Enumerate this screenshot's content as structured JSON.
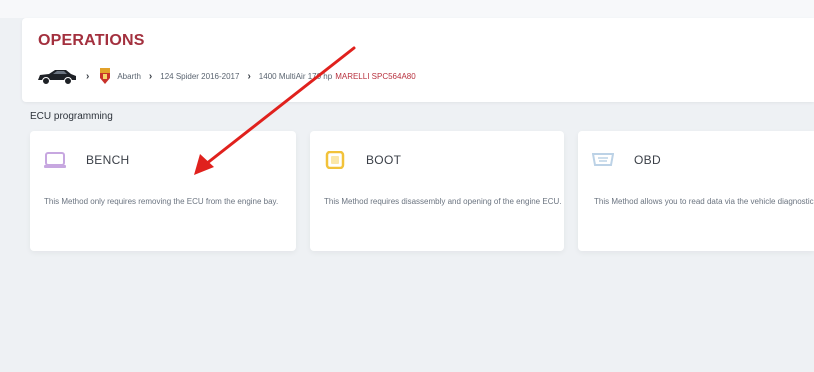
{
  "header": {
    "title": "OPERATIONS"
  },
  "breadcrumb": {
    "brand": "Abarth",
    "model": "124 Spider 2016-2017",
    "engine": "1400 MultiAir 170 hp",
    "ecu": "MARELLI SPC564A80"
  },
  "section": {
    "label": "ECU programming"
  },
  "methods": [
    {
      "title": "BENCH",
      "description": "This Method only requires removing the ECU from the engine bay.",
      "icon": "bench-icon"
    },
    {
      "title": "BOOT",
      "description": "This Method requires disassembly and opening of the engine ECU.",
      "icon": "boot-icon"
    },
    {
      "title": "OBD",
      "description": "This Method allows you to read data via the vehicle diagnostic socket.",
      "icon": "obd-icon"
    }
  ],
  "colors": {
    "title": "#a3303e",
    "ecu_highlight": "#b8323f",
    "arrow": "#e0211d",
    "bench_icon": "#c7a7e0",
    "boot_icon": "#f2c23a",
    "obd_icon": "#bcd2e6",
    "background": "#eef1f4"
  }
}
